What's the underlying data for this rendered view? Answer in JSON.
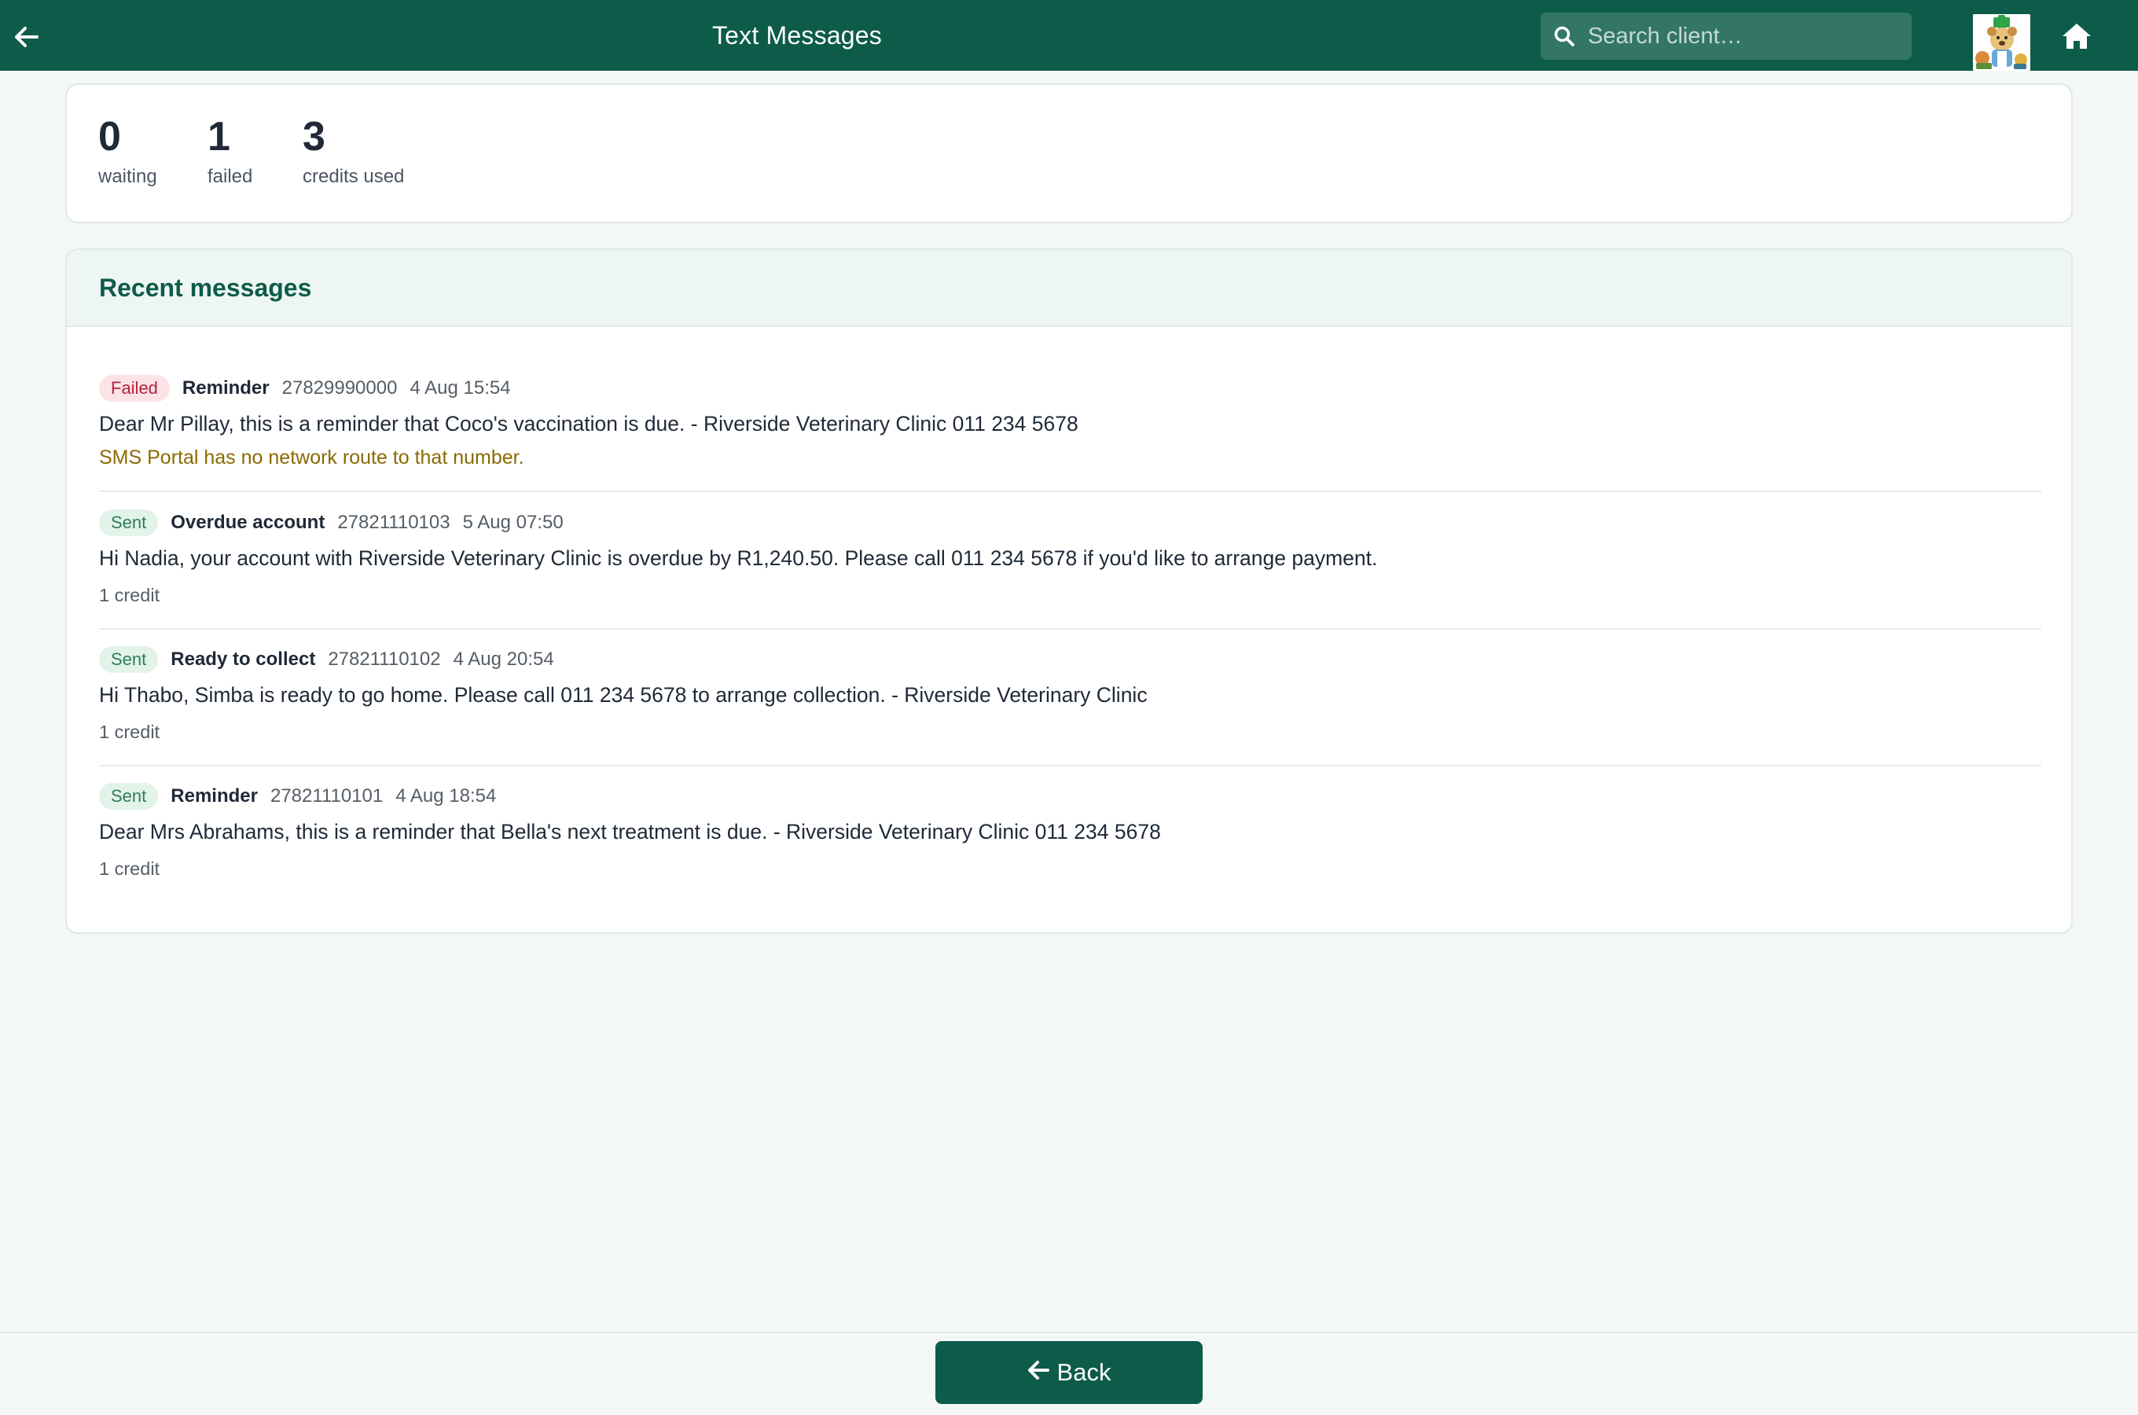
{
  "header": {
    "title": "Text Messages",
    "search_placeholder": "Search client…"
  },
  "stats": [
    {
      "value": "0",
      "label": "waiting"
    },
    {
      "value": "1",
      "label": "failed"
    },
    {
      "value": "3",
      "label": "credits used"
    }
  ],
  "recent": {
    "title": "Recent messages",
    "messages": [
      {
        "status": "Failed",
        "kind": "Reminder",
        "phone": "27829990000",
        "time": "4 Aug 15:54",
        "body": "Dear Mr Pillay, this is a reminder that Coco's vaccination is due. - Riverside Veterinary Clinic 011 234 5678",
        "error": "SMS Portal has no network route to that number."
      },
      {
        "status": "Sent",
        "kind": "Overdue account",
        "phone": "27821110103",
        "time": "5 Aug 07:50",
        "body": "Hi Nadia, your account with Riverside Veterinary Clinic is overdue by R1,240.50. Please call 011 234 5678 if you'd like to arrange payment.",
        "credit": "1 credit"
      },
      {
        "status": "Sent",
        "kind": "Ready to collect",
        "phone": "27821110102",
        "time": "4 Aug 20:54",
        "body": "Hi Thabo, Simba is ready to go home. Please call 011 234 5678 to arrange collection. - Riverside Veterinary Clinic",
        "credit": "1 credit"
      },
      {
        "status": "Sent",
        "kind": "Reminder",
        "phone": "27821110101",
        "time": "4 Aug 18:54",
        "body": "Dear Mrs Abrahams, this is a reminder that Bella's next treatment is due. - Riverside Veterinary Clinic 011 234 5678",
        "credit": "1 credit"
      }
    ]
  },
  "footer": {
    "back_label": "Back"
  },
  "colors": {
    "brand": "#0d5c49",
    "failed_badge_bg": "#fbe3e6",
    "failed_badge_text": "#b4233c",
    "sent_badge_bg": "#e2f3ea",
    "sent_badge_text": "#2e7d55",
    "error_text": "#8a6a00"
  },
  "icons": {
    "back": "arrow-left-icon",
    "search": "search-icon",
    "home": "home-icon",
    "logo": "clinic-logo"
  }
}
